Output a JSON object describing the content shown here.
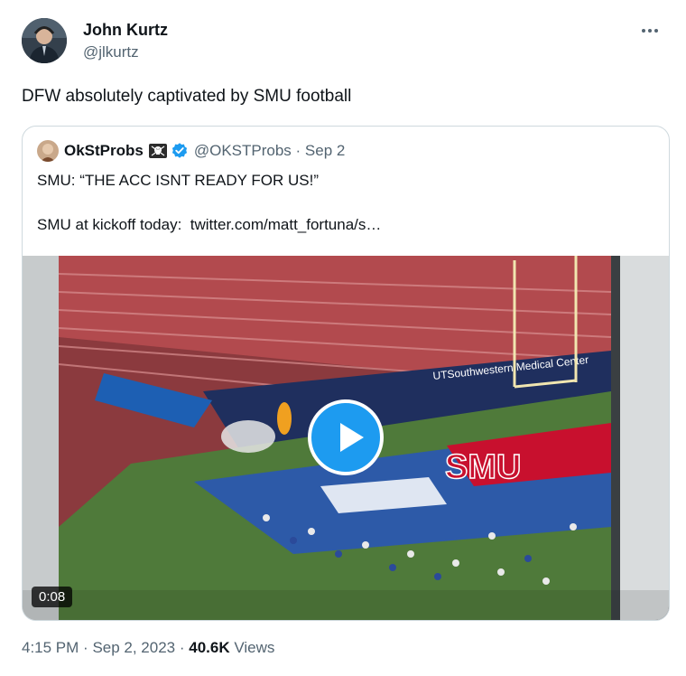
{
  "author": {
    "name": "John Kurtz",
    "handle": "@jlkurtz"
  },
  "tweet": {
    "text": "DFW absolutely captivated by SMU football"
  },
  "quoted": {
    "name": "OkStProbs",
    "handle": "@OKSTProbs",
    "date": "Sep 2",
    "line1": "SMU: “THE ACC ISNT READY FOR US!”",
    "line2_prefix": "SMU at kickoff today:",
    "line2_link": "twitter.com/matt_fortuna/s…",
    "video_duration": "0:08",
    "stadium_sign": "UTSouthwestern Medical Center",
    "banner_text": "SMU"
  },
  "footer": {
    "time": "4:15 PM",
    "date": "Sep 2, 2023",
    "views_count": "40.6K",
    "views_label": "Views"
  },
  "icons": {
    "more": "more-dots-icon",
    "verified": "verified-badge-icon",
    "skull": "skull-crossbones-icon",
    "play": "play-icon"
  },
  "colors": {
    "verified": "#1d9bf0",
    "secondary_text": "#536471",
    "border": "#cfd9de"
  }
}
